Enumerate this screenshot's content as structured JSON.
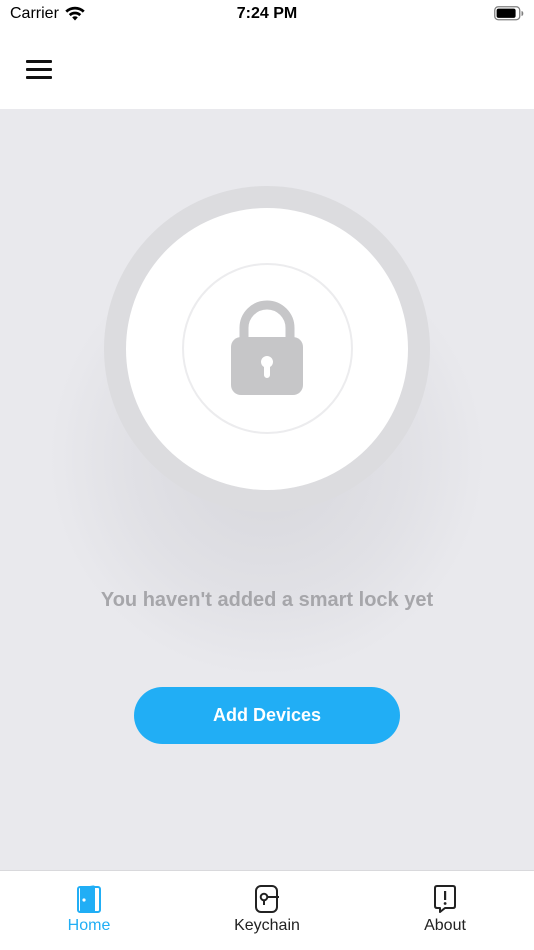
{
  "status_bar": {
    "carrier": "Carrier",
    "time": "7:24 PM",
    "icons": [
      "wifi-icon",
      "battery-icon"
    ]
  },
  "nav_bar": {
    "menu_icon": "hamburger-menu-icon"
  },
  "main": {
    "lock_icon": "padlock-icon",
    "empty_message": "You haven't added a smart lock yet",
    "add_devices_label": "Add Devices"
  },
  "tab_bar": {
    "tabs": [
      {
        "label": "Home",
        "icon": "door-icon",
        "active": true
      },
      {
        "label": "Keychain",
        "icon": "key-card-icon",
        "active": false
      },
      {
        "label": "About",
        "icon": "info-exclamation-icon",
        "active": false
      }
    ]
  },
  "colors": {
    "accent": "#21aef5",
    "background": "#e9e9ed",
    "lock_gray": "#c6c6c8",
    "message_gray": "#a6a6aa",
    "tab_inactive": "#222222"
  }
}
